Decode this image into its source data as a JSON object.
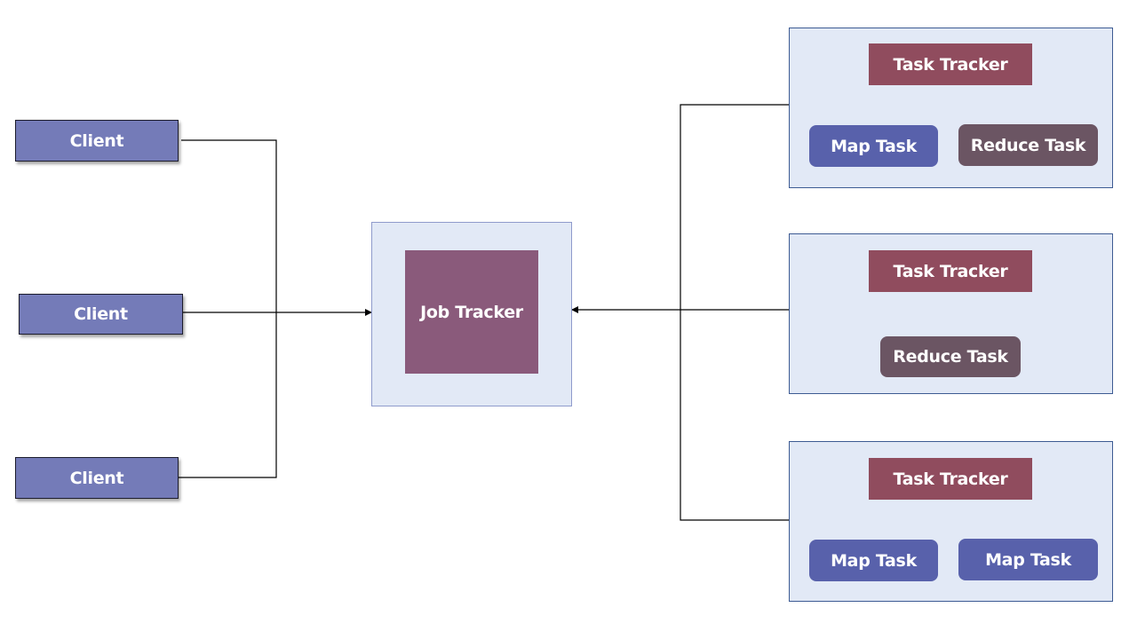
{
  "diagram": {
    "colors": {
      "client": "#747bb8",
      "panel": "#e2e9f6",
      "job_tracker": "#8a5a7b",
      "task_tracker": "#904c5e",
      "map_task": "#5861ab",
      "reduce_task": "#6b5563"
    },
    "clients": [
      {
        "label": "Client"
      },
      {
        "label": "Client"
      },
      {
        "label": "Client"
      }
    ],
    "job_tracker": {
      "label": "Job Tracker"
    },
    "nodes": [
      {
        "task_tracker": "Task Tracker",
        "tasks": [
          "Map Task",
          "Reduce Task"
        ]
      },
      {
        "task_tracker": "Task Tracker",
        "tasks": [
          "Reduce Task"
        ]
      },
      {
        "task_tracker": "Task Tracker",
        "tasks": [
          "Map Task",
          "Map Task"
        ]
      }
    ]
  }
}
